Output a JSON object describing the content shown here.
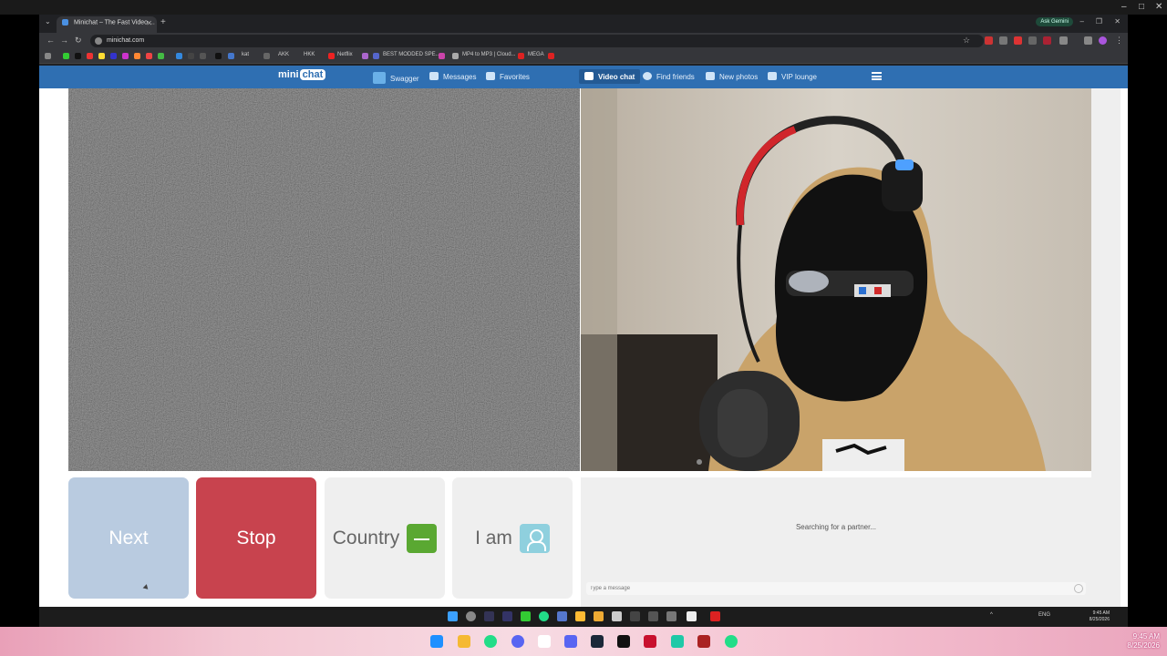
{
  "browser": {
    "tab_title": "Minichat – The Fast Video ...",
    "url": "minichat.com",
    "ask_gemini": "Ask Gemini",
    "bookmarks": [
      "kat",
      "AKK",
      "HKK",
      "Netflix",
      "BEST MODDED SPE...",
      "MP4 to MP3 | Cloud...",
      "MEGA"
    ]
  },
  "site": {
    "logo_mini": "mini",
    "logo_chat": "chat",
    "nav": [
      {
        "label": "Swagger",
        "icon": "swagger-icon",
        "color": "#6ab0e8"
      },
      {
        "label": "Messages",
        "icon": "messages-icon",
        "color": "#d0e4f7"
      },
      {
        "label": "Favorites",
        "icon": "favorites-icon",
        "color": "#d0e4f7"
      },
      {
        "label": "Video chat",
        "icon": "video-chat-icon",
        "color": "#ffffff"
      },
      {
        "label": "Find friends",
        "icon": "find-friends-icon",
        "color": "#d0e4f7"
      },
      {
        "label": "New photos",
        "icon": "new-photos-icon",
        "color": "#d0e4f7"
      },
      {
        "label": "VIP lounge",
        "icon": "vip-crown-icon",
        "color": "#d0e4f7"
      }
    ]
  },
  "controls": {
    "next": "Next",
    "stop": "Stop",
    "country": "Country",
    "iam": "I am"
  },
  "chat": {
    "status": "Searching for a partner...",
    "placeholder": "Type a message"
  },
  "clock": {
    "time": "9:45 AM",
    "date": "8/25/2026",
    "lang": "ENG"
  },
  "colors": {
    "nav_bar": "#2f6fb2",
    "next_button": "#b9cbe0",
    "stop_button": "#c8434e"
  }
}
